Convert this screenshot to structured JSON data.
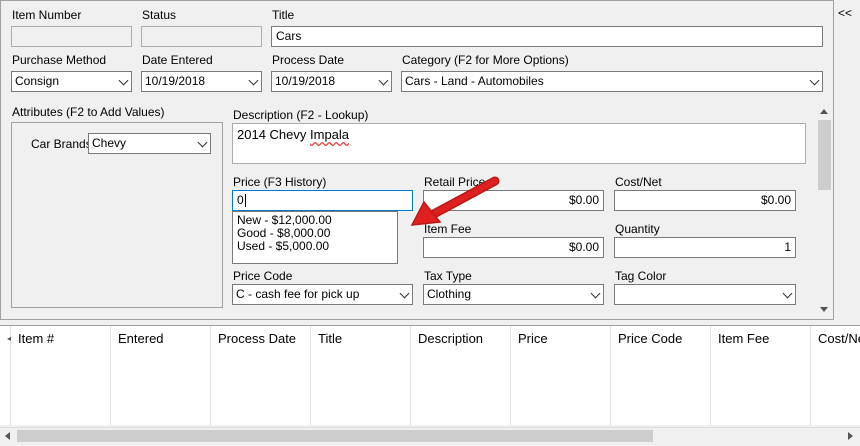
{
  "collapse_label": "<<",
  "top": {
    "item_number": {
      "label": "Item Number",
      "value": ""
    },
    "status": {
      "label": "Status",
      "value": ""
    },
    "title": {
      "label": "Title",
      "value": "Cars"
    },
    "purchase_method": {
      "label": "Purchase Method",
      "value": "Consign"
    },
    "date_entered": {
      "label": "Date Entered",
      "value": "10/19/2018"
    },
    "process_date": {
      "label": "Process Date",
      "value": "10/19/2018"
    },
    "category": {
      "label": "Category (F2 for More Options)",
      "value": "Cars - Land - Automobiles"
    }
  },
  "attributes": {
    "label": "Attributes (F2 to Add Values)",
    "car_brands": {
      "label": "Car Brands",
      "value": "Chevy"
    }
  },
  "description": {
    "label": "Description (F2 - Lookup)",
    "value_plain": "2014 Chevy ",
    "value_misspelled": "Impala"
  },
  "price": {
    "label": "Price (F3 History)",
    "value": "0",
    "history": [
      "New - $12,000.00",
      "Good - $8,000.00",
      "Used - $5,000.00"
    ]
  },
  "retail_price": {
    "label": "Retail Price",
    "value": "$0.00"
  },
  "cost_net": {
    "label": "Cost/Net",
    "value": "$0.00"
  },
  "item_fee": {
    "label": "Item Fee",
    "value": "$0.00"
  },
  "quantity": {
    "label": "Quantity",
    "value": "1"
  },
  "price_code": {
    "label": "Price Code",
    "value": "C - cash fee for pick up"
  },
  "tax_type": {
    "label": "Tax Type",
    "value": "Clothing"
  },
  "tag_color": {
    "label": "Tag Color",
    "value": ""
  },
  "annotation_color": "#e02020",
  "grid": {
    "columns": [
      "Item #",
      "Entered",
      "Process Date",
      "Title",
      "Description",
      "Price",
      "Price Code",
      "Item Fee",
      "Cost/Net"
    ]
  }
}
